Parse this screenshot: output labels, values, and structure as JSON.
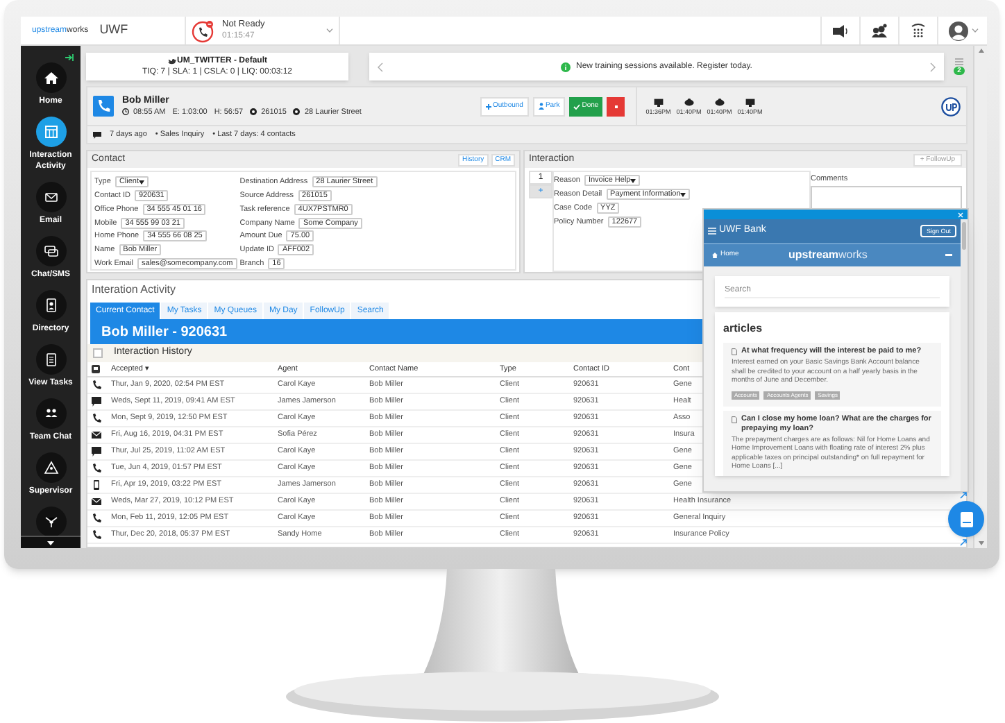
{
  "top_bar": {
    "logo": {
      "brand": "upstream",
      "suffix": "works"
    },
    "app_name": "UWF",
    "status": {
      "label": "Not Ready",
      "timer": "01:15:47"
    }
  },
  "sidebar": {
    "items": [
      {
        "label": "Home",
        "kind": "home",
        "selected": false
      },
      {
        "label": "Interaction Activity",
        "kind": "activity",
        "selected": true
      },
      {
        "label": "Email",
        "kind": "email",
        "selected": false
      },
      {
        "label": "Chat/SMS",
        "kind": "chat",
        "selected": false
      },
      {
        "label": "Directory",
        "kind": "directory",
        "selected": false
      },
      {
        "label": "View Tasks",
        "kind": "tasks",
        "selected": false
      },
      {
        "label": "Team Chat",
        "kind": "team",
        "selected": false
      },
      {
        "label": "Supervisor",
        "kind": "supervisor",
        "selected": false
      },
      {
        "kind": "network",
        "selected": false
      }
    ]
  },
  "queue": {
    "name": "UM_TWITTER - Default",
    "stats": "TIQ: 7 | SLA: 1 | CSLA: 0 | LIQ: 00:03:12"
  },
  "notification": {
    "message": "New training sessions available. Register today.",
    "badge": "2"
  },
  "contact_header": {
    "name": "Bob Miller",
    "time": "08:55 AM",
    "elapsed": "E: 1:03:00",
    "hold": "H: 56:57",
    "source": "261015",
    "address": "28 Laurier Street",
    "buttons": [
      {
        "label": "Outbound",
        "kind": "outbound"
      },
      {
        "label": "Park",
        "kind": "park"
      },
      {
        "label": "Done",
        "kind": "done"
      },
      {
        "kind": "stop"
      }
    ],
    "events": [
      {
        "kind": "screen",
        "time": "01:36PM"
      },
      {
        "kind": "blob",
        "time": "01:40PM"
      },
      {
        "kind": "blob",
        "time": "01:40PM"
      },
      {
        "kind": "screen",
        "time": "01:40PM"
      }
    ],
    "summary": [
      "7 days ago",
      "• Sales Inquiry",
      "• Last 7 days: 4 contacts"
    ]
  },
  "contact": {
    "title": "Contact",
    "buttons": [
      "History",
      "CRM"
    ],
    "left_fields": [
      {
        "label": "Type",
        "value": "Client",
        "kind": "select"
      },
      {
        "label": "Contact ID",
        "value": "920631",
        "kind": "text"
      },
      {
        "label": "Office Phone",
        "value": "34 555 45 01 16",
        "kind": "text"
      },
      {
        "label": "Mobile",
        "value": "34 555 99 03 21",
        "kind": "text"
      },
      {
        "label": "Home Phone",
        "value": "34 555 66 08 25",
        "kind": "text"
      },
      {
        "label": "Name",
        "value": "Bob Miller",
        "kind": "text"
      },
      {
        "label": "Work Email",
        "value": "sales@somecompany.com",
        "kind": "text"
      }
    ],
    "right_fields": [
      {
        "label": "Destination Address",
        "value": "28 Laurier Street",
        "kind": "text"
      },
      {
        "label": "Source Address",
        "value": "261015",
        "kind": "text"
      },
      {
        "label": "Task reference",
        "value": "4UX7PSTMR0",
        "kind": "text"
      },
      {
        "label": "Company Name",
        "value": "Some Company",
        "kind": "text"
      },
      {
        "label": "Amount Due",
        "value": "75.00",
        "kind": "text"
      },
      {
        "label": "Update ID",
        "value": "AFF002",
        "kind": "text"
      },
      {
        "label": "Branch",
        "value": "16",
        "kind": "text"
      }
    ]
  },
  "interaction": {
    "title": "Interaction",
    "followup": "+ FollowUp",
    "tabs": [
      {
        "label": "1",
        "selected": true
      },
      {
        "label": "+",
        "selected": false
      }
    ],
    "fields": [
      {
        "label": "Reason",
        "value": "Invoice Help",
        "kind": "select"
      },
      {
        "label": "Reason Detail",
        "value": "Payment Information",
        "kind": "select"
      },
      {
        "label": "Case Code",
        "value": "YYZ",
        "kind": "text"
      },
      {
        "label": "Policy Number",
        "value": "122677",
        "kind": "text"
      }
    ],
    "comments_label": "Comments"
  },
  "activity": {
    "title": "Interation Activity",
    "tabs": [
      {
        "label": "Current Contact",
        "selected": true
      },
      {
        "label": "My Tasks",
        "selected": false
      },
      {
        "label": "My Queues",
        "selected": false
      },
      {
        "label": "My Day",
        "selected": false
      },
      {
        "label": "FollowUp",
        "selected": false
      },
      {
        "label": "Search",
        "selected": false
      }
    ],
    "banner": "Bob Miller - 920631",
    "history_title": "Interaction History",
    "history_checked": false,
    "columns": [
      "Accepted ▾",
      "Agent",
      "Contact Name",
      "Type",
      "Contact ID",
      "Cont"
    ],
    "rows": [
      {
        "kind": "phone",
        "cells": [
          "Thur, Jan 9, 2020, 02:54 PM EST",
          "Carol Kaye",
          "Bob Miller",
          "Client",
          "920631",
          "Gene"
        ]
      },
      {
        "kind": "chat",
        "cells": [
          "Weds, Sept 11, 2019, 09:41 AM EST",
          "James Jamerson",
          "Bob Miller",
          "Client",
          "920631",
          "Healt"
        ]
      },
      {
        "kind": "phone",
        "cells": [
          "Mon, Sept 9, 2019, 12:50 PM EST",
          "Carol Kaye",
          "Bob Miller",
          "Client",
          "920631",
          "Asso"
        ]
      },
      {
        "kind": "email",
        "cells": [
          "Fri, Aug 16, 2019, 04:31 PM EST",
          "Sofia Pérez",
          "Bob Miller",
          "Client",
          "920631",
          "Insura"
        ]
      },
      {
        "kind": "chat",
        "cells": [
          "Thur, Jul 25, 2019, 11:02 AM EST",
          "Carol Kaye",
          "Bob Miller",
          "Client",
          "920631",
          "Gene"
        ]
      },
      {
        "kind": "phone",
        "cells": [
          "Tue, Jun 4, 2019, 01:57 PM EST",
          "Carol Kaye",
          "Bob Miller",
          "Client",
          "920631",
          "Gene"
        ]
      },
      {
        "kind": "mobile",
        "cells": [
          "Fri, Apr 19, 2019, 03:22 PM EST",
          "James Jamerson",
          "Bob Miller",
          "Client",
          "920631",
          "Gene"
        ]
      },
      {
        "kind": "email",
        "cells": [
          "Weds, Mar 27, 2019, 10:12 PM EST",
          "Carol Kaye",
          "Bob Miller",
          "Client",
          "920631",
          "Health Insurance"
        ]
      },
      {
        "kind": "phone",
        "cells": [
          "Mon, Feb 11, 2019, 12:05 PM EST",
          "Carol Kaye",
          "Bob Miller",
          "Client",
          "920631",
          "General Inquiry"
        ]
      },
      {
        "kind": "phone",
        "cells": [
          "Thur, Dec 20, 2018, 05:37 PM EST",
          "Sandy Home",
          "Bob Miller",
          "Client",
          "920631",
          "Insurance Policy"
        ]
      }
    ]
  },
  "kb_widget": {
    "bank": "UWF Bank",
    "sign_out": "Sign Out",
    "home": "Home",
    "logo": {
      "brand": "upstream",
      "suffix": "works"
    },
    "search_placeholder": "Search",
    "heading": "articles",
    "articles": [
      {
        "title": "At what frequency will the interest be paid to me?",
        "body": "Interest earned on your Basic Savings Bank Account balance shall be credited to your account on a half yearly basis in the months of June and December.",
        "tags": [
          "Accounts",
          "Accounts Agents",
          "Savings"
        ]
      },
      {
        "title": "Can I close my home loan? What are the charges for prepaying my loan?",
        "body": "The prepayment charges are as follows: Nil for Home Loans and Home Improvement Loans with floating rate of interest 2% plus applicable taxes on principal outstanding* on full repayment for Home Loans [...]"
      }
    ]
  }
}
